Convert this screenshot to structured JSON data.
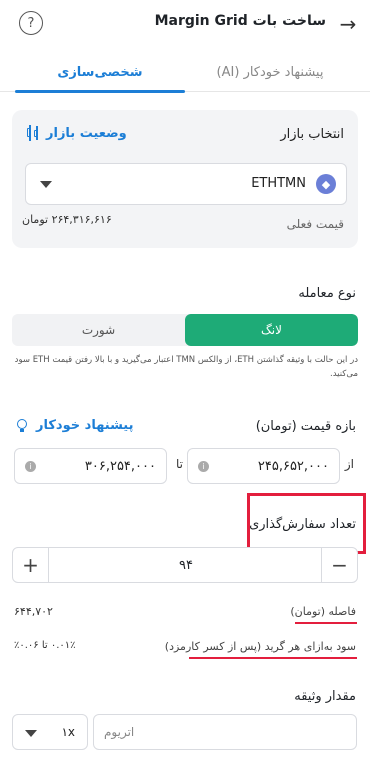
{
  "header": {
    "title": "ساخت بات Margin Grid",
    "back_icon": "arrow-right-icon",
    "help_icon": "question-circle-icon",
    "help_glyph": "?"
  },
  "tabs": [
    {
      "label": "شخصی‌سازی",
      "active": true
    },
    {
      "label": "پیشنهاد خودکار (AI)",
      "active": false
    }
  ],
  "market": {
    "label": "انتخاب بازار",
    "status_link": "وضعیت بازار",
    "symbol": "ETHTMN",
    "coin_glyph": "◆",
    "current_price_label": "قیمت فعلی",
    "current_price_value": "۲۶۴,۳۱۶,۶۱۶ تومان"
  },
  "trade_type": {
    "title": "نوع معامله",
    "long_label": "لانگ",
    "short_label": "شورت",
    "selected": "long",
    "description": "در این حالت با وثیقه گذاشتن ETH، از والکس TMN اعتبار می‌گیرید و با بالا رفتن قیمت ETH سود می‌کنید."
  },
  "price_range": {
    "title": "بازه قیمت (تومان)",
    "auto_suggest": "پیشنهاد خودکار",
    "from_label": "از",
    "to_label": "تا",
    "from_value": "۲۴۵,۶۵۲,۰۰۰",
    "to_value": "۳۰۶,۲۵۴,۰۰۰",
    "info_glyph": "i"
  },
  "orders": {
    "title": "تعداد سفارش‌گذاری",
    "value": "۹۴",
    "minus": "−",
    "plus": "+"
  },
  "info": {
    "gap_label": "فاصله (تومان)",
    "gap_value": "۶۴۴,۷۰۲",
    "profit_label": "سود به‌ازای هر گرید (پس از کسر کارمزد)",
    "profit_value": "۰.۰۱٪ تا ۰.۰۶٪"
  },
  "collateral": {
    "title": "مقدار وثیقه",
    "placeholder": "اتریوم",
    "leverage": "۱x"
  },
  "colors": {
    "accent": "#1c7ed6",
    "long_green": "#1eab77",
    "highlight_red": "#e31e3d"
  }
}
